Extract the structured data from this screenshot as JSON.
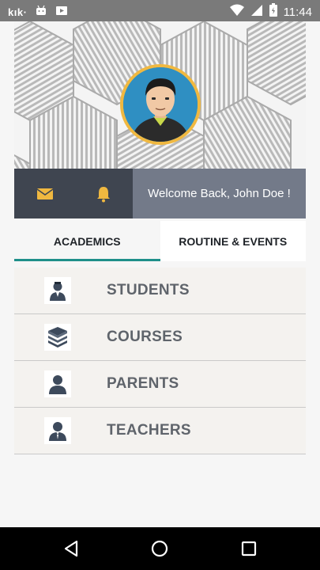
{
  "status_bar": {
    "carrier_label": "kık·",
    "time": "11:44"
  },
  "header": {
    "welcome_text": "Welcome Back, John Doe !"
  },
  "tabs": [
    {
      "label": "ACADEMICS",
      "active": true
    },
    {
      "label": "ROUTINE & EVENTS",
      "active": false
    }
  ],
  "menu": [
    {
      "label": "STUDENTS",
      "icon": "student-icon"
    },
    {
      "label": "COURSES",
      "icon": "books-icon"
    },
    {
      "label": "PARENTS",
      "icon": "parent-icon"
    },
    {
      "label": "TEACHERS",
      "icon": "teacher-icon"
    }
  ],
  "colors": {
    "accent": "#1e8f8a",
    "icon_gold": "#f0b840",
    "dark_panel": "#3f4550",
    "welcome_panel": "#737a89"
  }
}
